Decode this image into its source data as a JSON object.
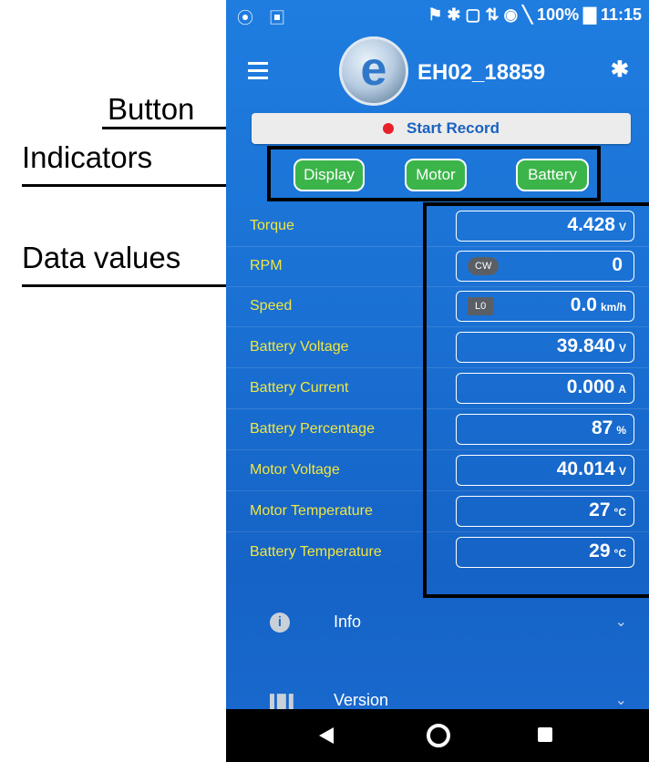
{
  "annotations": {
    "button": "Button",
    "indicators": "Indicators",
    "data_values": "Data values"
  },
  "statusbar": {
    "left_icons": "⦿ ▣",
    "right": "⚑ ✱ ▢ ⇅ ◉ ╲ 100% ▇ 11:15",
    "battery_percent": "100%",
    "time": "11:15"
  },
  "appbar": {
    "logo_letter": "e",
    "device_name": "EH02_18859",
    "bluetooth_glyph": "✱"
  },
  "record": {
    "label": "Start Record",
    "dot_color": "#e8202a"
  },
  "indicators": [
    {
      "label": "Display",
      "color": "#3bb54a"
    },
    {
      "label": "Motor",
      "color": "#3bb54a"
    },
    {
      "label": "Battery",
      "color": "#3bb54a"
    }
  ],
  "rows": [
    {
      "label": "Torque",
      "value": "4.428",
      "unit": "V"
    },
    {
      "label": "RPM",
      "tag": "CW",
      "value": "0",
      "unit": ""
    },
    {
      "label": "Speed",
      "tag": "L0",
      "value": "0.0",
      "unit": "km/h"
    },
    {
      "label": "Battery Voltage",
      "value": "39.840",
      "unit": "V"
    },
    {
      "label": "Battery Current",
      "value": "0.000",
      "unit": "A"
    },
    {
      "label": "Battery Percentage",
      "value": "87",
      "unit": "%"
    },
    {
      "label": "Motor Voltage",
      "value": "40.014",
      "unit": "V"
    },
    {
      "label": "Motor Temperature",
      "value": "27",
      "unit": "°C"
    },
    {
      "label": "Battery Temperature",
      "value": "29",
      "unit": "°C"
    }
  ],
  "sections": [
    {
      "label": "Info",
      "icon": "info-icon",
      "glyph": "i"
    },
    {
      "label": "Version",
      "icon": "version-icon",
      "glyph": "▌█▐"
    }
  ],
  "navbar": {
    "back": "back",
    "home": "home",
    "recents": "recents"
  }
}
